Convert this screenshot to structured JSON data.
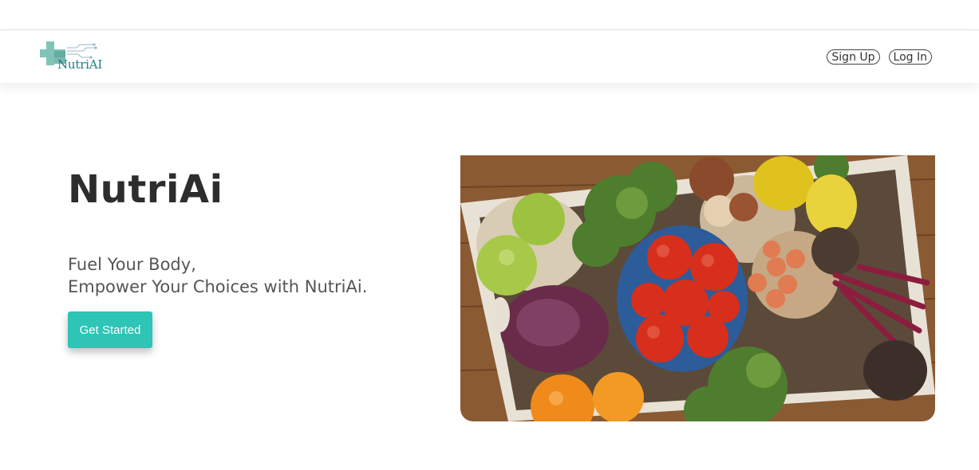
{
  "brand": {
    "logo_text": "NutriAI"
  },
  "nav": {
    "signup_label": "Sign Up",
    "login_label": "Log In"
  },
  "hero": {
    "title": "NutriAi",
    "tagline_line1": "Fuel Your Body,",
    "tagline_line2": "Empower Your Choices with NutriAi.",
    "cta_label": "Get Started",
    "image_subject": "crate of fresh vegetables and fruit",
    "accent_color": "#2ec4b6"
  }
}
